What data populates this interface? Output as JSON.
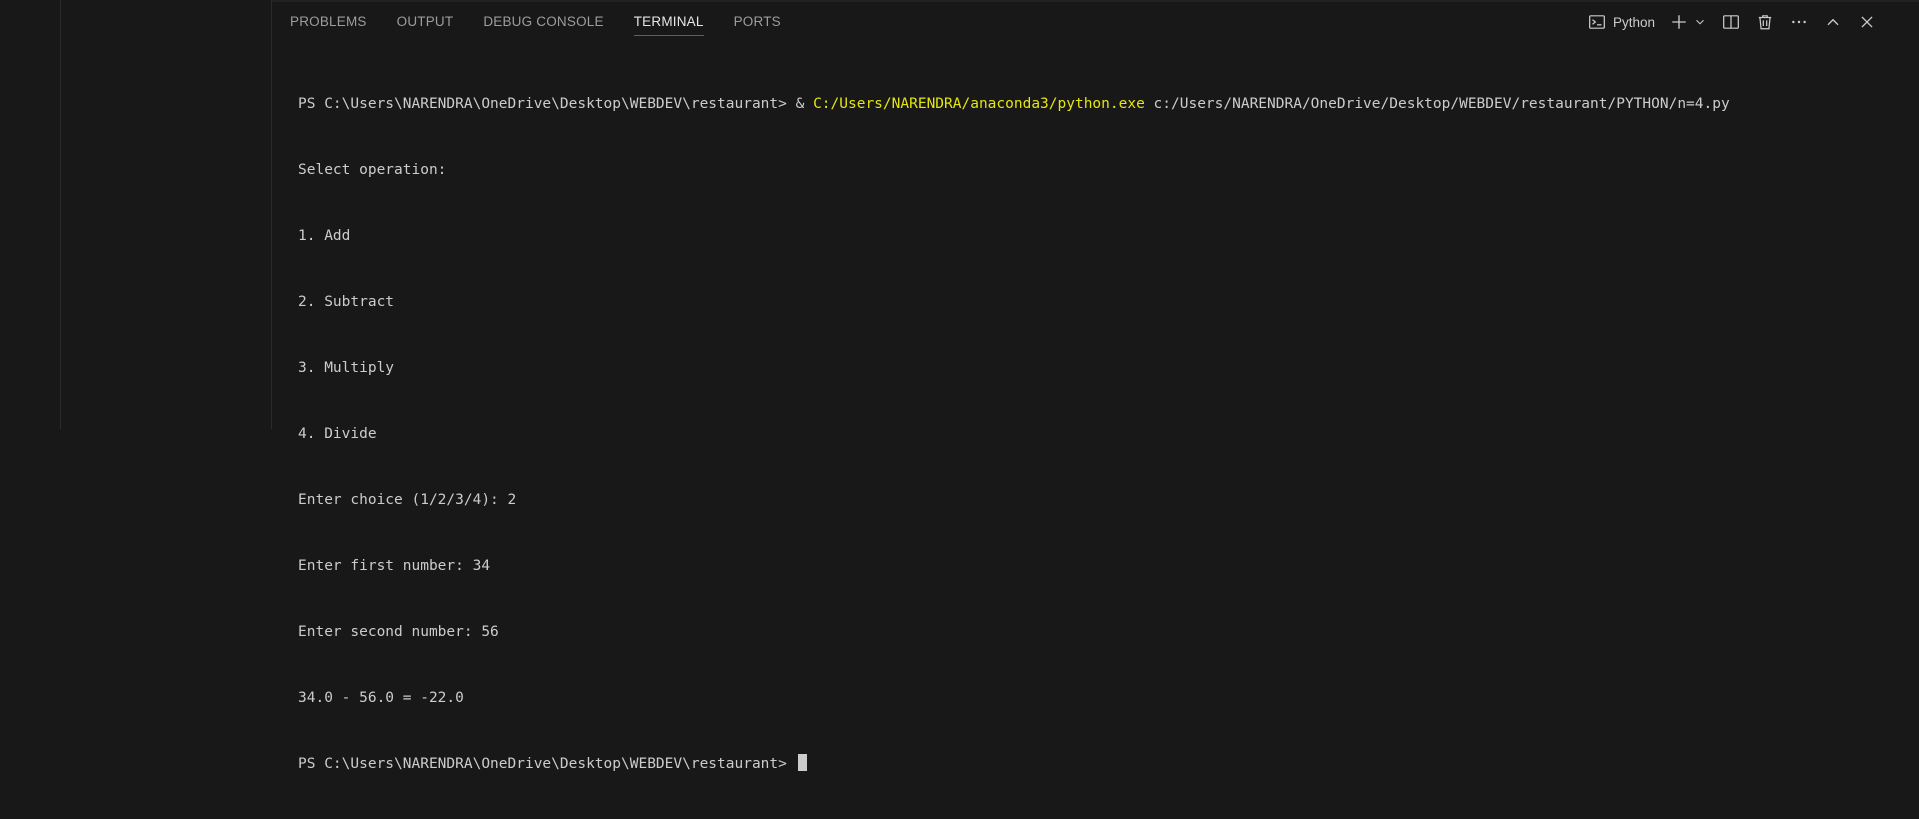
{
  "panel": {
    "tabs": [
      {
        "label": "PROBLEMS"
      },
      {
        "label": "OUTPUT"
      },
      {
        "label": "DEBUG CONSOLE"
      },
      {
        "label": "TERMINAL"
      },
      {
        "label": "PORTS"
      }
    ],
    "active_tab": "TERMINAL",
    "terminal_label": "Python"
  },
  "icons": {
    "terminal": "terminal-icon",
    "add": "plus-icon",
    "dropdown": "chevron-down-icon",
    "split": "split-icon",
    "kill": "trash-icon",
    "more": "ellipsis-icon",
    "maximize": "chevron-up-icon",
    "close": "close-icon"
  },
  "colors": {
    "accent": "#0078d4",
    "command_highlight": "#e5e510"
  },
  "terminal": {
    "prompt_path": "PS C:\\Users\\NARENDRA\\OneDrive\\Desktop\\WEBDEV\\restaurant>",
    "command_amp": "&",
    "command_exe": "C:/Users/NARENDRA/anaconda3/python.exe",
    "command_arg": "c:/Users/NARENDRA/OneDrive/Desktop/WEBDEV/restaurant/PYTHON/n=4.py",
    "output_lines": [
      "Select operation:",
      "1. Add",
      "2. Subtract",
      "3. Multiply",
      "4. Divide",
      "Enter choice (1/2/3/4): 2",
      "Enter first number: 34",
      "Enter second number: 56",
      "34.0 - 56.0 = -22.0"
    ],
    "final_prompt": "PS C:\\Users\\NARENDRA\\OneDrive\\Desktop\\WEBDEV\\restaurant>"
  }
}
